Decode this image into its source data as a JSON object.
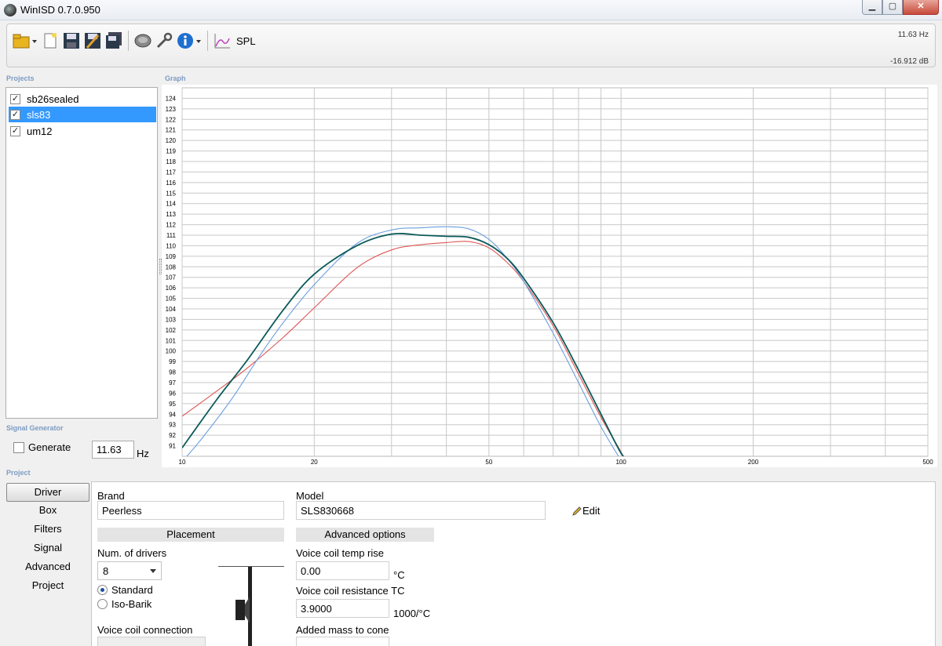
{
  "window": {
    "title": "WinISD 0.7.0.950",
    "min": "▁",
    "max": "▢",
    "close": "✕"
  },
  "toolbar": {
    "spl_label": "SPL",
    "freq_readout": "11.63 Hz",
    "db_readout": "-16.912 dB"
  },
  "sections": {
    "projects": "Projects",
    "graph": "Graph",
    "signal_generator": "Signal Generator",
    "project": "Project"
  },
  "projects": [
    {
      "name": "sb26sealed",
      "checked": true,
      "check": "✓"
    },
    {
      "name": "sls83",
      "checked": true,
      "check": "✓",
      "selected": true
    },
    {
      "name": "um12",
      "checked": true,
      "check": "✓"
    }
  ],
  "signal_generator": {
    "generate_label": "Generate",
    "frequency": "11.63",
    "unit": "Hz"
  },
  "nav": [
    "Driver",
    "Box",
    "Filters",
    "Signal",
    "Advanced",
    "Project"
  ],
  "driver": {
    "brand_label": "Brand",
    "brand_value": "Peerless",
    "model_label": "Model",
    "model_value": "SLS830668",
    "edit_label": "Edit",
    "placement_header": "Placement",
    "num_drivers_label": "Num. of drivers",
    "num_drivers_value": "8",
    "standard_label": "Standard",
    "isobarik_label": "Iso-Barik",
    "vc_connection_label": "Voice coil connection",
    "advanced_header": "Advanced options",
    "vc_temp_label": "Voice coil temp rise",
    "vc_temp_value": "0.00",
    "vc_temp_unit": "°C",
    "vc_res_tc_label": "Voice coil resistance TC",
    "vc_res_tc_value": "3.9000",
    "vc_res_tc_unit": "1000/°C",
    "added_mass_label": "Added mass to cone"
  },
  "colors": {
    "selection": "#3399ff",
    "section_label": "#7c9cc3"
  },
  "chart_data": {
    "type": "line",
    "xscale": "log",
    "xlim": [
      10,
      500
    ],
    "ylim": [
      90,
      125
    ],
    "x_ticks": [
      10,
      20,
      50,
      100,
      200,
      500
    ],
    "y_ticks": [
      91,
      92,
      93,
      94,
      95,
      96,
      97,
      98,
      99,
      100,
      101,
      102,
      103,
      104,
      105,
      106,
      107,
      108,
      109,
      110,
      111,
      112,
      113,
      114,
      115,
      116,
      117,
      118,
      119,
      120,
      121,
      122,
      123,
      124
    ],
    "grid": true,
    "series": [
      {
        "color": "#0b5a5a",
        "x": [
          10,
          12,
          14,
          17,
          20,
          25,
          30,
          35,
          40,
          45,
          50,
          55,
          60,
          70,
          80,
          90,
          100,
          105
        ],
        "y": [
          90.8,
          95.4,
          99.0,
          103.9,
          107.3,
          110.0,
          111.1,
          111.0,
          110.9,
          110.8,
          110.1,
          108.8,
          106.9,
          102.7,
          98.2,
          94.0,
          90.3,
          89.5
        ]
      },
      {
        "color": "#6a9fe0",
        "x": [
          10,
          11,
          13,
          15,
          17,
          20,
          25,
          30,
          35,
          40,
          45,
          50,
          55,
          60,
          70,
          80,
          90,
          100
        ],
        "y": [
          89.5,
          91.5,
          95.5,
          99.5,
          102.7,
          106.3,
          110.2,
          111.5,
          111.7,
          111.8,
          111.6,
          110.6,
          108.8,
          106.6,
          101.7,
          97.0,
          92.8,
          89.6
        ]
      },
      {
        "color": "#e05555",
        "x": [
          10,
          12,
          14,
          17,
          20,
          25,
          30,
          35,
          40,
          45,
          50,
          55,
          60,
          70,
          80,
          90,
          100,
          102
        ],
        "y": [
          93.8,
          96.2,
          98.3,
          101.3,
          104.1,
          107.9,
          109.6,
          110.1,
          110.3,
          110.4,
          109.8,
          108.4,
          106.6,
          102.4,
          97.8,
          93.7,
          90.4,
          89.5
        ]
      }
    ]
  }
}
